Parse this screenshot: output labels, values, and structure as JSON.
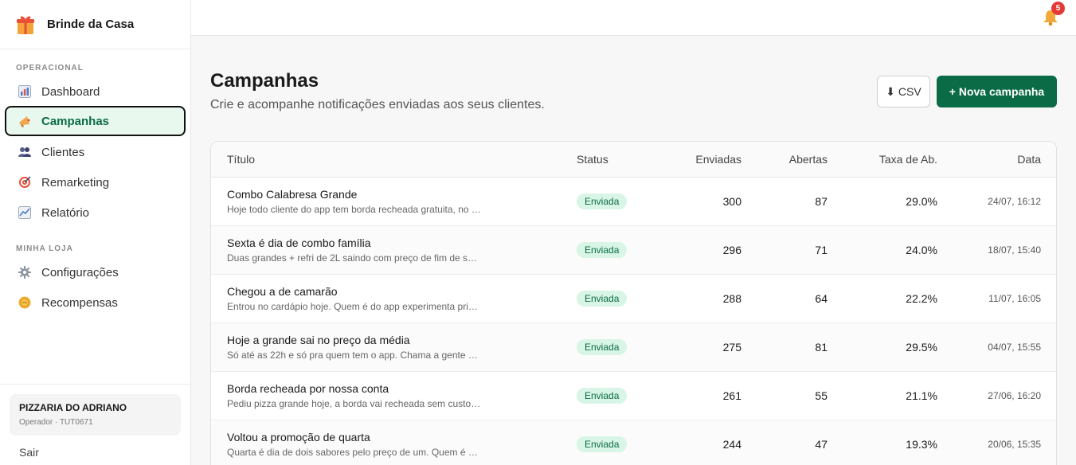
{
  "brand": {
    "name": "Brinde da Casa"
  },
  "sidebar": {
    "section_operacional": "OPERACIONAL",
    "section_loja": "MINHA LOJA",
    "items": [
      {
        "label": "Dashboard",
        "icon": "bar-chart-icon"
      },
      {
        "label": "Campanhas",
        "icon": "megaphone-icon",
        "active": true
      },
      {
        "label": "Clientes",
        "icon": "users-icon"
      },
      {
        "label": "Remarketing",
        "icon": "target-icon"
      },
      {
        "label": "Relatório",
        "icon": "line-chart-icon"
      },
      {
        "label": "Configurações",
        "icon": "gear-icon"
      },
      {
        "label": "Recompensas",
        "icon": "coin-icon"
      }
    ],
    "store": {
      "name": "PIZZARIA DO ADRIANO",
      "sub": "Operador · TUT0671"
    },
    "logout": "Sair"
  },
  "topbar": {
    "notifications": "5"
  },
  "main": {
    "title": "Campanhas",
    "subtitle": "Crie e acompanhe notificações enviadas aos seus clientes.",
    "csv_label": "⬇ CSV",
    "new_label": "+ Nova campanha"
  },
  "table": {
    "headers": {
      "titulo": "Título",
      "status": "Status",
      "enviadas": "Enviadas",
      "abertas": "Abertas",
      "taxa": "Taxa de Ab.",
      "data": "Data"
    },
    "rows": [
      {
        "title": "Combo Calabresa Grande",
        "desc": "Hoje todo cliente do app tem borda recheada gratuita, no …",
        "status": "Enviada",
        "enviadas": "300",
        "abertas": "87",
        "taxa": "29.0%",
        "data": "24/07, 16:12"
      },
      {
        "title": "Sexta é dia de combo família",
        "desc": "Duas grandes + refri de 2L saindo com preço de fim de s…",
        "status": "Enviada",
        "enviadas": "296",
        "abertas": "71",
        "taxa": "24.0%",
        "data": "18/07, 15:40"
      },
      {
        "title": "Chegou a de camarão",
        "desc": "Entrou no cardápio hoje. Quem é do app experimenta pri…",
        "status": "Enviada",
        "enviadas": "288",
        "abertas": "64",
        "taxa": "22.2%",
        "data": "11/07, 16:05"
      },
      {
        "title": "Hoje a grande sai no preço da média",
        "desc": "Só até as 22h e só pra quem tem o app. Chama a gente …",
        "status": "Enviada",
        "enviadas": "275",
        "abertas": "81",
        "taxa": "29.5%",
        "data": "04/07, 15:55"
      },
      {
        "title": "Borda recheada por nossa conta",
        "desc": "Pediu pizza grande hoje, a borda vai recheada sem custo…",
        "status": "Enviada",
        "enviadas": "261",
        "abertas": "55",
        "taxa": "21.1%",
        "data": "27/06, 16:20"
      },
      {
        "title": "Voltou a promoção de quarta",
        "desc": "Quarta é dia de dois sabores pelo preço de um. Quem é …",
        "status": "Enviada",
        "enviadas": "244",
        "abertas": "47",
        "taxa": "19.3%",
        "data": "20/06, 15:35"
      }
    ]
  },
  "colors": {
    "accent": "#0b6b47",
    "badge_bg": "#d8f5e5",
    "notification": "#e53935"
  }
}
